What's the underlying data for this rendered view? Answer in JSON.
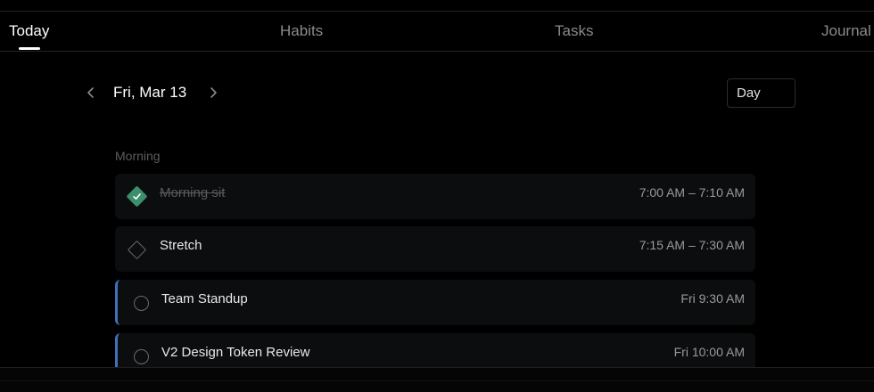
{
  "tabs": [
    {
      "label": "Today",
      "active": true
    },
    {
      "label": "Habits",
      "active": false
    },
    {
      "label": "Tasks",
      "active": false
    },
    {
      "label": "Journal",
      "active": false
    }
  ],
  "date_nav": {
    "date_label": "Fri, Mar 13",
    "prev_icon": "chevron-left-icon",
    "next_icon": "chevron-right-icon",
    "view_mode": "Day"
  },
  "section": {
    "label": "Morning",
    "items": [
      {
        "title": "Morning sit",
        "time": "7:00 AM – 7:10 AM",
        "status": "done"
      },
      {
        "title": "Stretch",
        "time": "7:15 AM – 7:30 AM",
        "status": "open"
      },
      {
        "title": "Team Standup",
        "time": "Fri 9:30 AM",
        "status": "event"
      },
      {
        "title": "V2 Design Token Review",
        "time": "Fri 10:00 AM",
        "status": "event"
      }
    ]
  },
  "colors": {
    "background": "#000000",
    "done_check": "#3b8f6b",
    "event_accent": "#3f6fb8",
    "item_background": "#0c0d0f"
  }
}
